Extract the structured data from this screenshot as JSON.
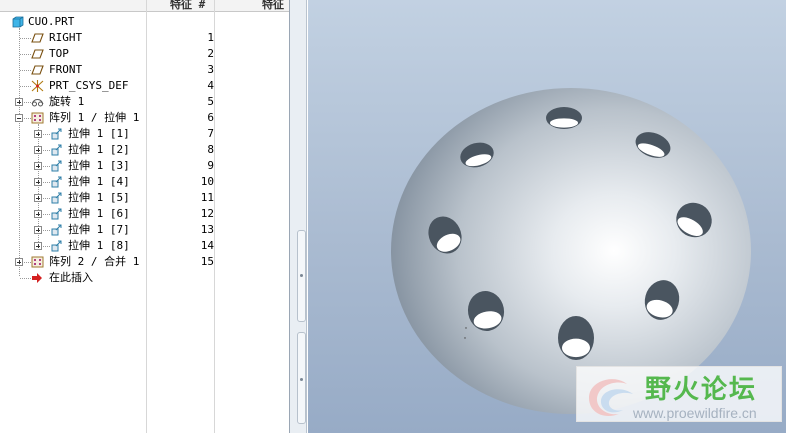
{
  "tree": {
    "columns": {
      "feature_num": "特征 #",
      "feature": "特征"
    },
    "root": {
      "label": "CUO.PRT",
      "icon": "part-icon"
    },
    "items": [
      {
        "label": "RIGHT",
        "num": "1",
        "icon": "datum-plane-icon"
      },
      {
        "label": "TOP",
        "num": "2",
        "icon": "datum-plane-icon"
      },
      {
        "label": "FRONT",
        "num": "3",
        "icon": "datum-plane-icon"
      },
      {
        "label": "PRT_CSYS_DEF",
        "num": "4",
        "icon": "coordinate-system-icon"
      },
      {
        "label": "旋转 1",
        "num": "5",
        "icon": "revolve-icon"
      },
      {
        "label": "阵列 1 / 拉伸 1",
        "num": "6",
        "icon": "pattern-icon"
      },
      {
        "label": "拉伸 1 [1]",
        "num": "7",
        "icon": "extrude-icon"
      },
      {
        "label": "拉伸 1 [2]",
        "num": "8",
        "icon": "extrude-icon"
      },
      {
        "label": "拉伸 1 [3]",
        "num": "9",
        "icon": "extrude-icon"
      },
      {
        "label": "拉伸 1 [4]",
        "num": "10",
        "icon": "extrude-icon"
      },
      {
        "label": "拉伸 1 [5]",
        "num": "11",
        "icon": "extrude-icon"
      },
      {
        "label": "拉伸 1 [6]",
        "num": "12",
        "icon": "extrude-icon"
      },
      {
        "label": "拉伸 1 [7]",
        "num": "13",
        "icon": "extrude-icon"
      },
      {
        "label": "拉伸 1 [8]",
        "num": "14",
        "icon": "extrude-icon"
      },
      {
        "label": "阵列 2 / 合并 1",
        "num": "15",
        "icon": "pattern-icon"
      }
    ],
    "insert_here": {
      "label": "在此插入",
      "icon": "insert-arrow-icon"
    }
  },
  "watermark": {
    "title": "野火论坛",
    "url": "www.proewildfire.cn"
  },
  "colors": {
    "viewport_top": "#c2d1e2",
    "viewport_bottom": "#97abc6",
    "model_gray": "#b9c2cb",
    "hole_white": "#ffffff",
    "insert_arrow": "#d42020",
    "watermark_green": "#55b84e"
  }
}
